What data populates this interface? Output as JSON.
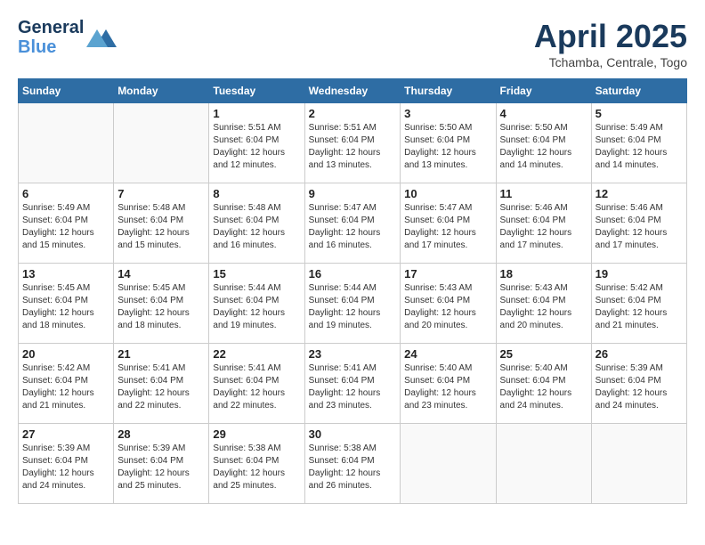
{
  "header": {
    "logo_line1": "General",
    "logo_line2": "Blue",
    "month_year": "April 2025",
    "location": "Tchamba, Centrale, Togo"
  },
  "weekdays": [
    "Sunday",
    "Monday",
    "Tuesday",
    "Wednesday",
    "Thursday",
    "Friday",
    "Saturday"
  ],
  "weeks": [
    [
      {
        "day": "",
        "info": ""
      },
      {
        "day": "",
        "info": ""
      },
      {
        "day": "1",
        "info": "Sunrise: 5:51 AM\nSunset: 6:04 PM\nDaylight: 12 hours\nand 12 minutes."
      },
      {
        "day": "2",
        "info": "Sunrise: 5:51 AM\nSunset: 6:04 PM\nDaylight: 12 hours\nand 13 minutes."
      },
      {
        "day": "3",
        "info": "Sunrise: 5:50 AM\nSunset: 6:04 PM\nDaylight: 12 hours\nand 13 minutes."
      },
      {
        "day": "4",
        "info": "Sunrise: 5:50 AM\nSunset: 6:04 PM\nDaylight: 12 hours\nand 14 minutes."
      },
      {
        "day": "5",
        "info": "Sunrise: 5:49 AM\nSunset: 6:04 PM\nDaylight: 12 hours\nand 14 minutes."
      }
    ],
    [
      {
        "day": "6",
        "info": "Sunrise: 5:49 AM\nSunset: 6:04 PM\nDaylight: 12 hours\nand 15 minutes."
      },
      {
        "day": "7",
        "info": "Sunrise: 5:48 AM\nSunset: 6:04 PM\nDaylight: 12 hours\nand 15 minutes."
      },
      {
        "day": "8",
        "info": "Sunrise: 5:48 AM\nSunset: 6:04 PM\nDaylight: 12 hours\nand 16 minutes."
      },
      {
        "day": "9",
        "info": "Sunrise: 5:47 AM\nSunset: 6:04 PM\nDaylight: 12 hours\nand 16 minutes."
      },
      {
        "day": "10",
        "info": "Sunrise: 5:47 AM\nSunset: 6:04 PM\nDaylight: 12 hours\nand 17 minutes."
      },
      {
        "day": "11",
        "info": "Sunrise: 5:46 AM\nSunset: 6:04 PM\nDaylight: 12 hours\nand 17 minutes."
      },
      {
        "day": "12",
        "info": "Sunrise: 5:46 AM\nSunset: 6:04 PM\nDaylight: 12 hours\nand 17 minutes."
      }
    ],
    [
      {
        "day": "13",
        "info": "Sunrise: 5:45 AM\nSunset: 6:04 PM\nDaylight: 12 hours\nand 18 minutes."
      },
      {
        "day": "14",
        "info": "Sunrise: 5:45 AM\nSunset: 6:04 PM\nDaylight: 12 hours\nand 18 minutes."
      },
      {
        "day": "15",
        "info": "Sunrise: 5:44 AM\nSunset: 6:04 PM\nDaylight: 12 hours\nand 19 minutes."
      },
      {
        "day": "16",
        "info": "Sunrise: 5:44 AM\nSunset: 6:04 PM\nDaylight: 12 hours\nand 19 minutes."
      },
      {
        "day": "17",
        "info": "Sunrise: 5:43 AM\nSunset: 6:04 PM\nDaylight: 12 hours\nand 20 minutes."
      },
      {
        "day": "18",
        "info": "Sunrise: 5:43 AM\nSunset: 6:04 PM\nDaylight: 12 hours\nand 20 minutes."
      },
      {
        "day": "19",
        "info": "Sunrise: 5:42 AM\nSunset: 6:04 PM\nDaylight: 12 hours\nand 21 minutes."
      }
    ],
    [
      {
        "day": "20",
        "info": "Sunrise: 5:42 AM\nSunset: 6:04 PM\nDaylight: 12 hours\nand 21 minutes."
      },
      {
        "day": "21",
        "info": "Sunrise: 5:41 AM\nSunset: 6:04 PM\nDaylight: 12 hours\nand 22 minutes."
      },
      {
        "day": "22",
        "info": "Sunrise: 5:41 AM\nSunset: 6:04 PM\nDaylight: 12 hours\nand 22 minutes."
      },
      {
        "day": "23",
        "info": "Sunrise: 5:41 AM\nSunset: 6:04 PM\nDaylight: 12 hours\nand 23 minutes."
      },
      {
        "day": "24",
        "info": "Sunrise: 5:40 AM\nSunset: 6:04 PM\nDaylight: 12 hours\nand 23 minutes."
      },
      {
        "day": "25",
        "info": "Sunrise: 5:40 AM\nSunset: 6:04 PM\nDaylight: 12 hours\nand 24 minutes."
      },
      {
        "day": "26",
        "info": "Sunrise: 5:39 AM\nSunset: 6:04 PM\nDaylight: 12 hours\nand 24 minutes."
      }
    ],
    [
      {
        "day": "27",
        "info": "Sunrise: 5:39 AM\nSunset: 6:04 PM\nDaylight: 12 hours\nand 24 minutes."
      },
      {
        "day": "28",
        "info": "Sunrise: 5:39 AM\nSunset: 6:04 PM\nDaylight: 12 hours\nand 25 minutes."
      },
      {
        "day": "29",
        "info": "Sunrise: 5:38 AM\nSunset: 6:04 PM\nDaylight: 12 hours\nand 25 minutes."
      },
      {
        "day": "30",
        "info": "Sunrise: 5:38 AM\nSunset: 6:04 PM\nDaylight: 12 hours\nand 26 minutes."
      },
      {
        "day": "",
        "info": ""
      },
      {
        "day": "",
        "info": ""
      },
      {
        "day": "",
        "info": ""
      }
    ]
  ]
}
